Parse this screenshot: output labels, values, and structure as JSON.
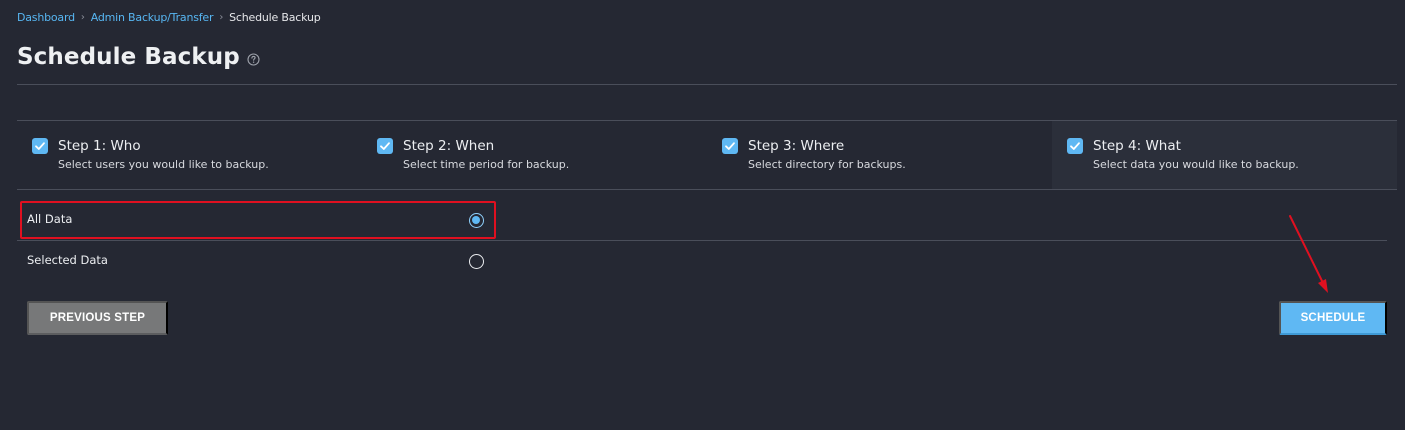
{
  "breadcrumb": {
    "items": [
      "Dashboard",
      "Admin Backup/Transfer"
    ],
    "current": "Schedule Backup",
    "separator": "›"
  },
  "page": {
    "title": "Schedule Backup",
    "help_icon": "question-circle-icon"
  },
  "steps": [
    {
      "title": "Step 1: Who",
      "description": "Select users you would like to backup.",
      "checked": true
    },
    {
      "title": "Step 2: When",
      "description": "Select time period for backup.",
      "checked": true
    },
    {
      "title": "Step 3: Where",
      "description": "Select directory for backups.",
      "checked": true
    },
    {
      "title": "Step 4: What",
      "description": "Select data you would like to backup.",
      "checked": true,
      "active": true
    }
  ],
  "options": [
    {
      "label": "All Data",
      "selected": true
    },
    {
      "label": "Selected Data",
      "selected": false
    }
  ],
  "buttons": {
    "previous": "PREVIOUS STEP",
    "schedule": "SCHEDULE"
  },
  "colors": {
    "background": "#252833",
    "accent": "#5fb8f3",
    "annotation": "#e01020"
  }
}
